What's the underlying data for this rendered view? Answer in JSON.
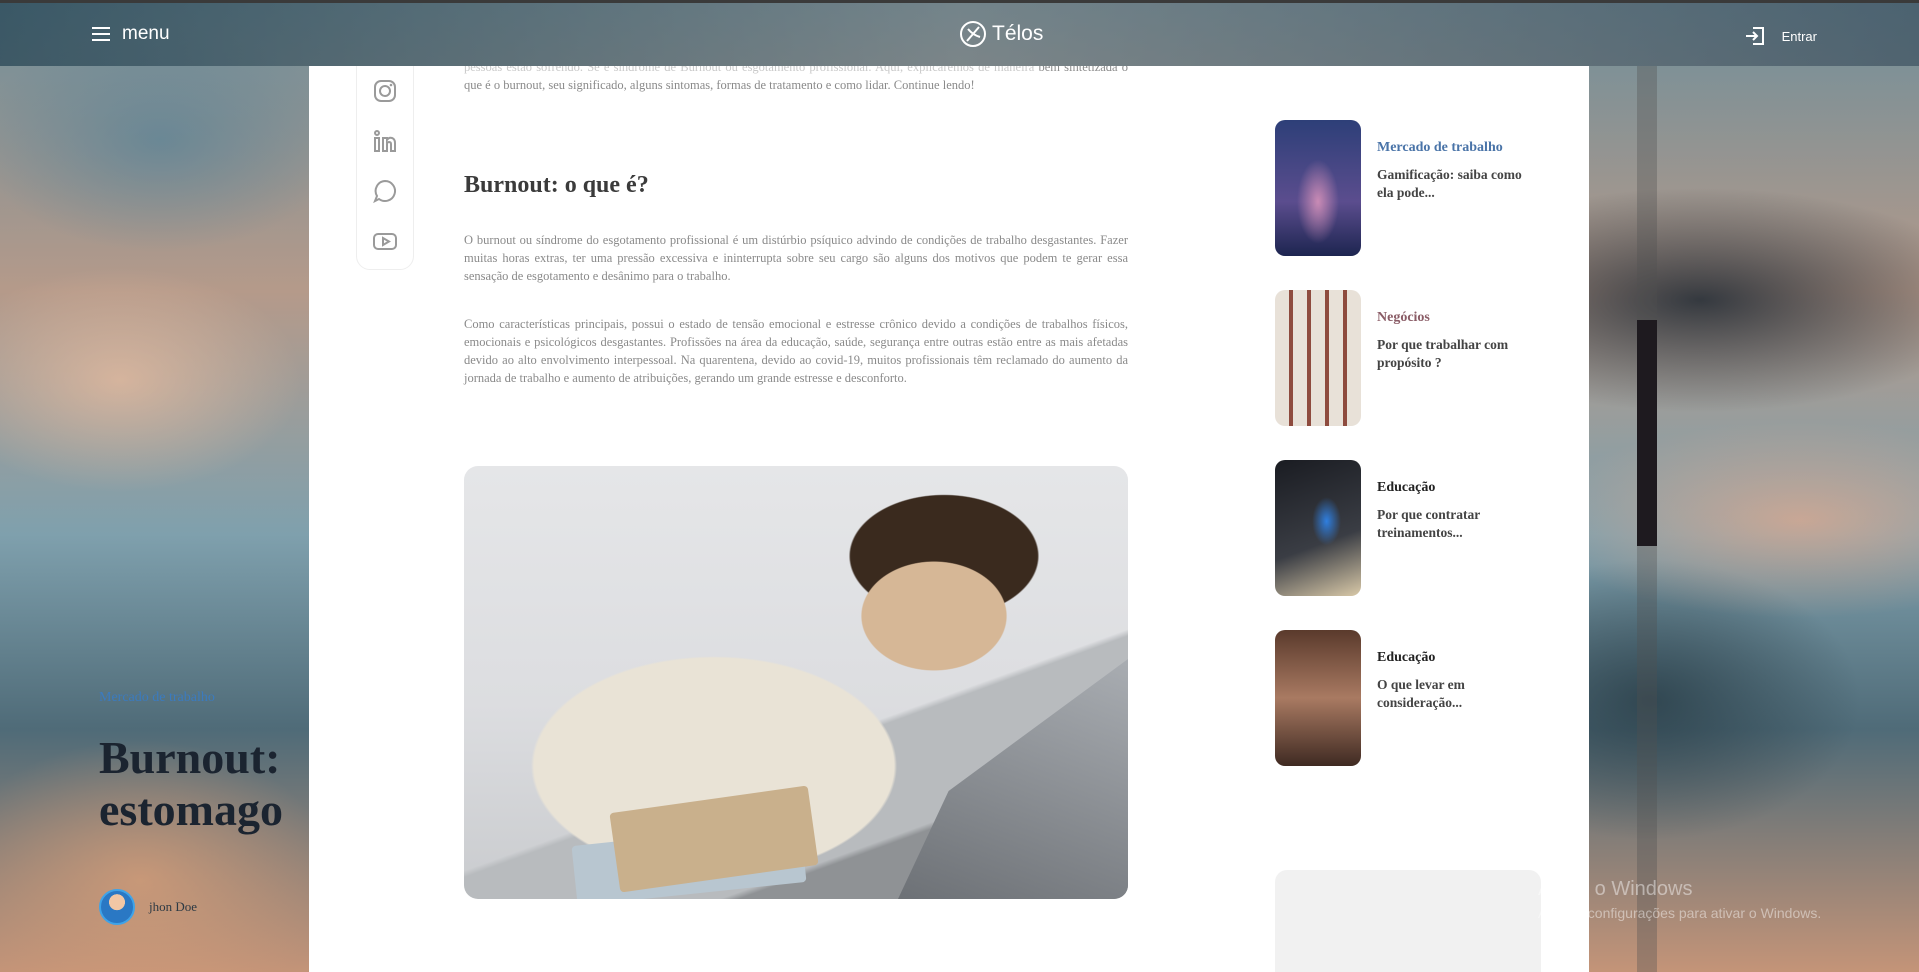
{
  "topbar": {
    "menu_label": "menu",
    "brand_name": "Télos",
    "login_label": "Entrar"
  },
  "hero": {
    "category": "Mercado de trabalho",
    "title_line1": "Burnout:",
    "title_line2": "estomago",
    "author_name": "jhon Doe"
  },
  "share": {
    "icons": [
      "instagram-icon",
      "linkedin-icon",
      "chat-icon",
      "youtube-icon"
    ]
  },
  "article": {
    "intro_faded": "pessoas estão sofrendo. Se é síndrome de Burnout ou esgotamento profissional. Aqui, explicaremos de maneira",
    "intro_visible": "bem sintetizada o que é o burnout, seu significado, alguns sintomas, formas de tratamento e como lidar. Continue lendo!",
    "heading": "Burnout: o que é?",
    "paragraph1": "O burnout ou síndrome do esgotamento profissional é um distúrbio psíquico advindo de condições de trabalho desgastantes. Fazer muitas horas extras, ter uma pressão excessiva e ininterrupta sobre seu cargo são alguns dos motivos que podem te gerar essa sensação de esgotamento e desânimo para o trabalho.",
    "paragraph2": "Como características principais, possui o estado de tensão emocional e estresse crônico devido a condições de trabalhos físicos, emocionais e psicológicos desgastantes. Profissões na área da educação, saúde, segurança entre outras estão entre as mais afetadas devido ao alto envolvimento interpessoal. Na quarentena, devido ao covid-19, muitos profissionais têm reclamado do aumento da jornada de trabalho e aumento de atribuições, gerando um grande estresse e desconforto."
  },
  "sidebar": {
    "items": [
      {
        "category": "Mercado de trabalho",
        "title": "Gamificação: saiba como ela pode...",
        "category_color": "#4a74a8"
      },
      {
        "category": "Negócios",
        "title": "Por que trabalhar com propósito ?",
        "category_color": "#8a5c66"
      },
      {
        "category": "Educação",
        "title": "Por que contratar treinamentos...",
        "category_color": "#222222"
      },
      {
        "category": "Educação",
        "title": "O que levar em consideração...",
        "category_color": "#222222"
      }
    ]
  },
  "watermark": {
    "line1": "Ativar o Windows",
    "line2": "Acesse configurações para ativar o Windows."
  },
  "colors": {
    "accent_blue": "#3b7bbf",
    "scroll_thumb": "#1e1a1f"
  }
}
